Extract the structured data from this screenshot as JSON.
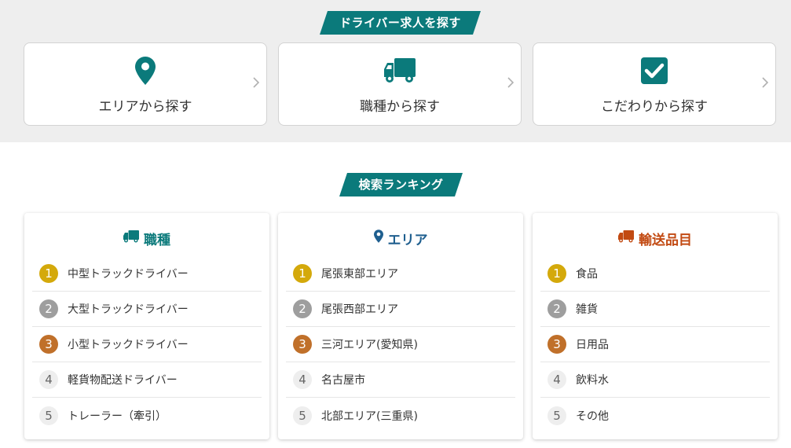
{
  "colors": {
    "teal": "#0b7a7b",
    "blue": "#1f5f8f",
    "orange": "#c24a12",
    "gold": "#d4a90b",
    "silver": "#9e9e9e",
    "bronze": "#c0702a"
  },
  "search": {
    "heading": "ドライバー求人を探す",
    "cards": [
      {
        "label": "エリアから探す",
        "icon": "map-pin-icon"
      },
      {
        "label": "職種から探す",
        "icon": "truck-icon"
      },
      {
        "label": "こだわりから探す",
        "icon": "checkbox-icon"
      }
    ]
  },
  "ranking": {
    "heading": "検索ランキング",
    "columns": [
      {
        "title": "職種",
        "icon": "truck-icon",
        "items": [
          {
            "rank": "1",
            "label": "中型トラックドライバー"
          },
          {
            "rank": "2",
            "label": "大型トラックドライバー"
          },
          {
            "rank": "3",
            "label": "小型トラックドライバー"
          },
          {
            "rank": "4",
            "label": "軽貨物配送ドライバー"
          },
          {
            "rank": "5",
            "label": "トレーラー（牽引）"
          }
        ]
      },
      {
        "title": "エリア",
        "icon": "map-pin-icon",
        "items": [
          {
            "rank": "1",
            "label": "尾張東部エリア"
          },
          {
            "rank": "2",
            "label": "尾張西部エリア"
          },
          {
            "rank": "3",
            "label": "三河エリア(愛知県)"
          },
          {
            "rank": "4",
            "label": "名古屋市"
          },
          {
            "rank": "5",
            "label": "北部エリア(三重県)"
          }
        ]
      },
      {
        "title": "輸送品目",
        "icon": "truck-icon",
        "items": [
          {
            "rank": "1",
            "label": "食品"
          },
          {
            "rank": "2",
            "label": "雑貨"
          },
          {
            "rank": "3",
            "label": "日用品"
          },
          {
            "rank": "4",
            "label": "飲料水"
          },
          {
            "rank": "5",
            "label": "その他"
          }
        ]
      }
    ]
  }
}
